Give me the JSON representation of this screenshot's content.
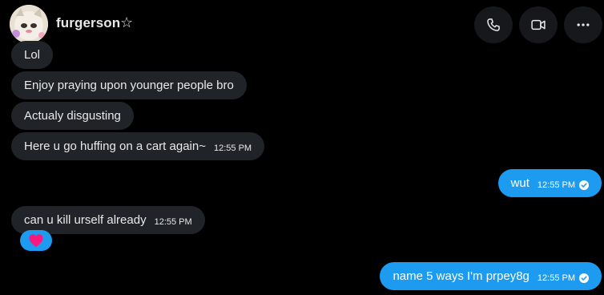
{
  "header": {
    "username": "furgerson",
    "star": "☆",
    "icons": {
      "call": "phone-icon",
      "video": "video-camera-icon",
      "more": "more-options-icon"
    }
  },
  "messages": [
    {
      "text": "Lol",
      "time": "",
      "direction": "incoming"
    },
    {
      "text": "Enjoy praying upon younger people bro",
      "time": "",
      "direction": "incoming"
    },
    {
      "text": "Actualy disgusting",
      "time": "",
      "direction": "incoming"
    },
    {
      "text": "Here u go huffing on a cart again~",
      "time": "12:55 PM",
      "direction": "incoming"
    },
    {
      "text": "wut",
      "time": "12:55 PM",
      "direction": "outgoing",
      "status": "sent-check-icon"
    },
    {
      "text": "can u kill urself already",
      "time": "12:55 PM",
      "direction": "incoming",
      "reaction": "heart-icon"
    },
    {
      "text": "name 5 ways I'm prpey8g",
      "time": "12:55 PM",
      "direction": "outgoing",
      "status": "sent-check-icon"
    }
  ],
  "colors": {
    "background": "#000000",
    "incoming_bubble": "#202327",
    "outgoing_bubble": "#1d9bf0",
    "reaction_heart": "#f91880"
  }
}
